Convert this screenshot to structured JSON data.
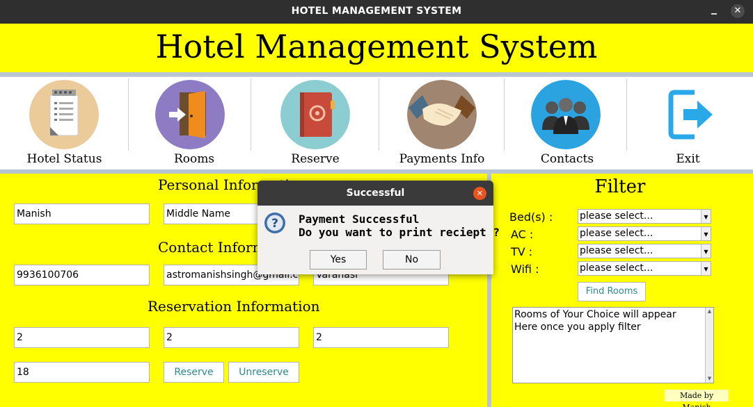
{
  "window": {
    "title": "HOTEL MANAGEMENT SYSTEM",
    "close_glyph": "✕"
  },
  "app": {
    "heading": "Hotel Management System"
  },
  "nav": [
    {
      "label": "Hotel Status",
      "icon": "clipboard-icon"
    },
    {
      "label": "Rooms",
      "icon": "door-icon"
    },
    {
      "label": "Reserve",
      "icon": "book-icon"
    },
    {
      "label": "Payments Info",
      "icon": "handshake-icon"
    },
    {
      "label": "Contacts",
      "icon": "people-icon"
    },
    {
      "label": "Exit",
      "icon": "exit-icon"
    }
  ],
  "personal": {
    "section_title": "Personal Information",
    "first_name": "Manish",
    "middle_name": "Middle Name"
  },
  "contact": {
    "section_title": "Contact Information",
    "phone": "9936100706",
    "email": "astromanishsingh@gmail.com",
    "city": "Varanasi"
  },
  "reservation": {
    "section_title": "Reservation Information",
    "field1": "2",
    "field2": "2",
    "field3": "2",
    "field4": "18",
    "reserve_label": "Reserve",
    "unreserve_label": "Unreserve"
  },
  "filter": {
    "title": "Filter",
    "beds_label": "Bed(s) :",
    "ac_label": "AC :",
    "tv_label": "TV :",
    "wifi_label": "Wifi :",
    "select_placeholder": "please select...",
    "find_label": "Find Rooms",
    "results_text": "Rooms of Your Choice will appear Here once you apply filter"
  },
  "credit": "Made by Manish",
  "dialog": {
    "title": "Successful",
    "line1": "Payment Successful",
    "line2": "Do you want to print reciept ?",
    "yes_label": "Yes",
    "no_label": "No"
  },
  "colors": {
    "panel_yellow": "#ffff00",
    "separator": "#b8c4d4",
    "titlebar": "#2f2f2f",
    "dialog_close": "#e95420",
    "button_text": "#2a8a8a"
  }
}
